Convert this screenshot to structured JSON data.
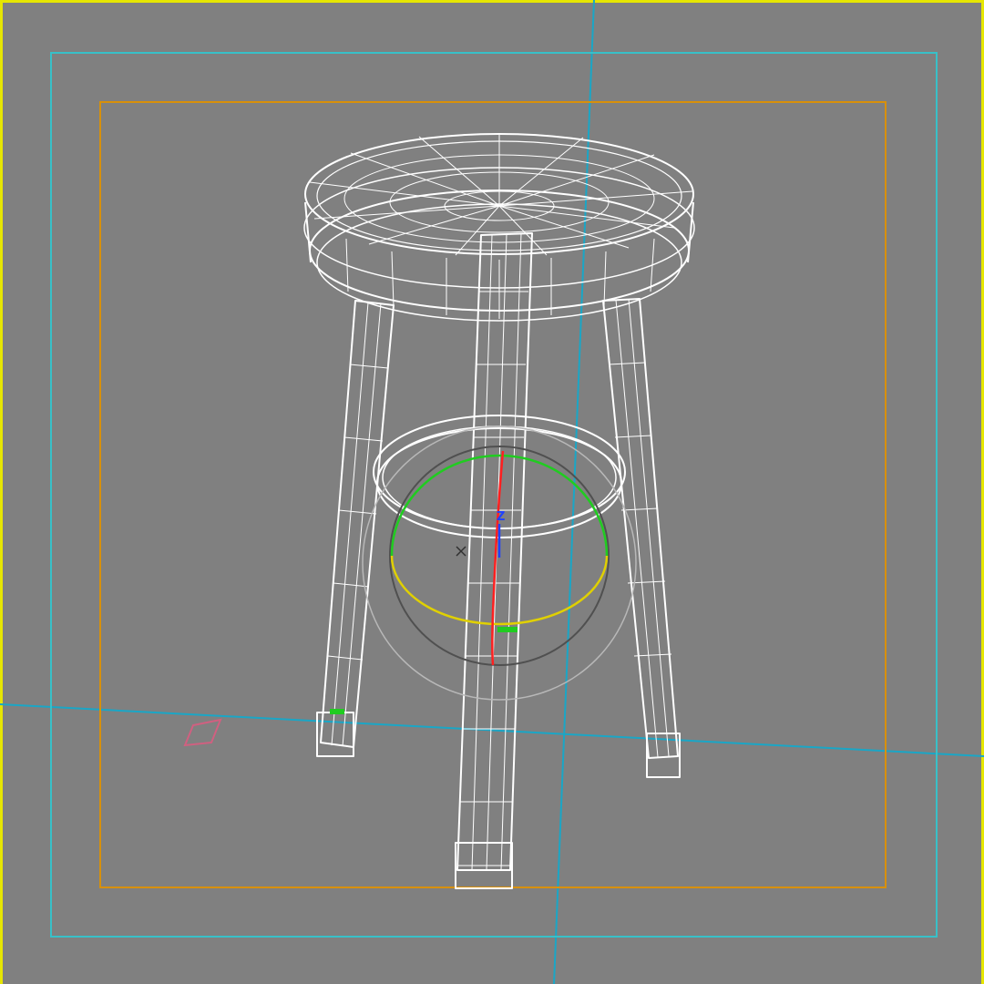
{
  "viewport": {
    "active": true,
    "background_color": "#808080",
    "active_border_color": "#e6e600"
  },
  "safe_frames": {
    "action_safe_color": "#38c0c8",
    "title_safe_color": "#d8900a"
  },
  "grid": {
    "axis_line_color": "#1aa6c6"
  },
  "object": {
    "type": "bar stool",
    "render_mode": "wireframe",
    "wire_color": "#ffffff"
  },
  "gizmo": {
    "type": "rotate",
    "axis_label": "Z",
    "x_axis_color": "#ff2020",
    "y_axis_color": "#20cc20",
    "z_axis_color": "#2040ff",
    "ring_color": "#e0d000",
    "trackball_color": "#505050",
    "screen_ring_color": "#b8b8b8"
  },
  "light_helper": {
    "color": "#d06080"
  }
}
